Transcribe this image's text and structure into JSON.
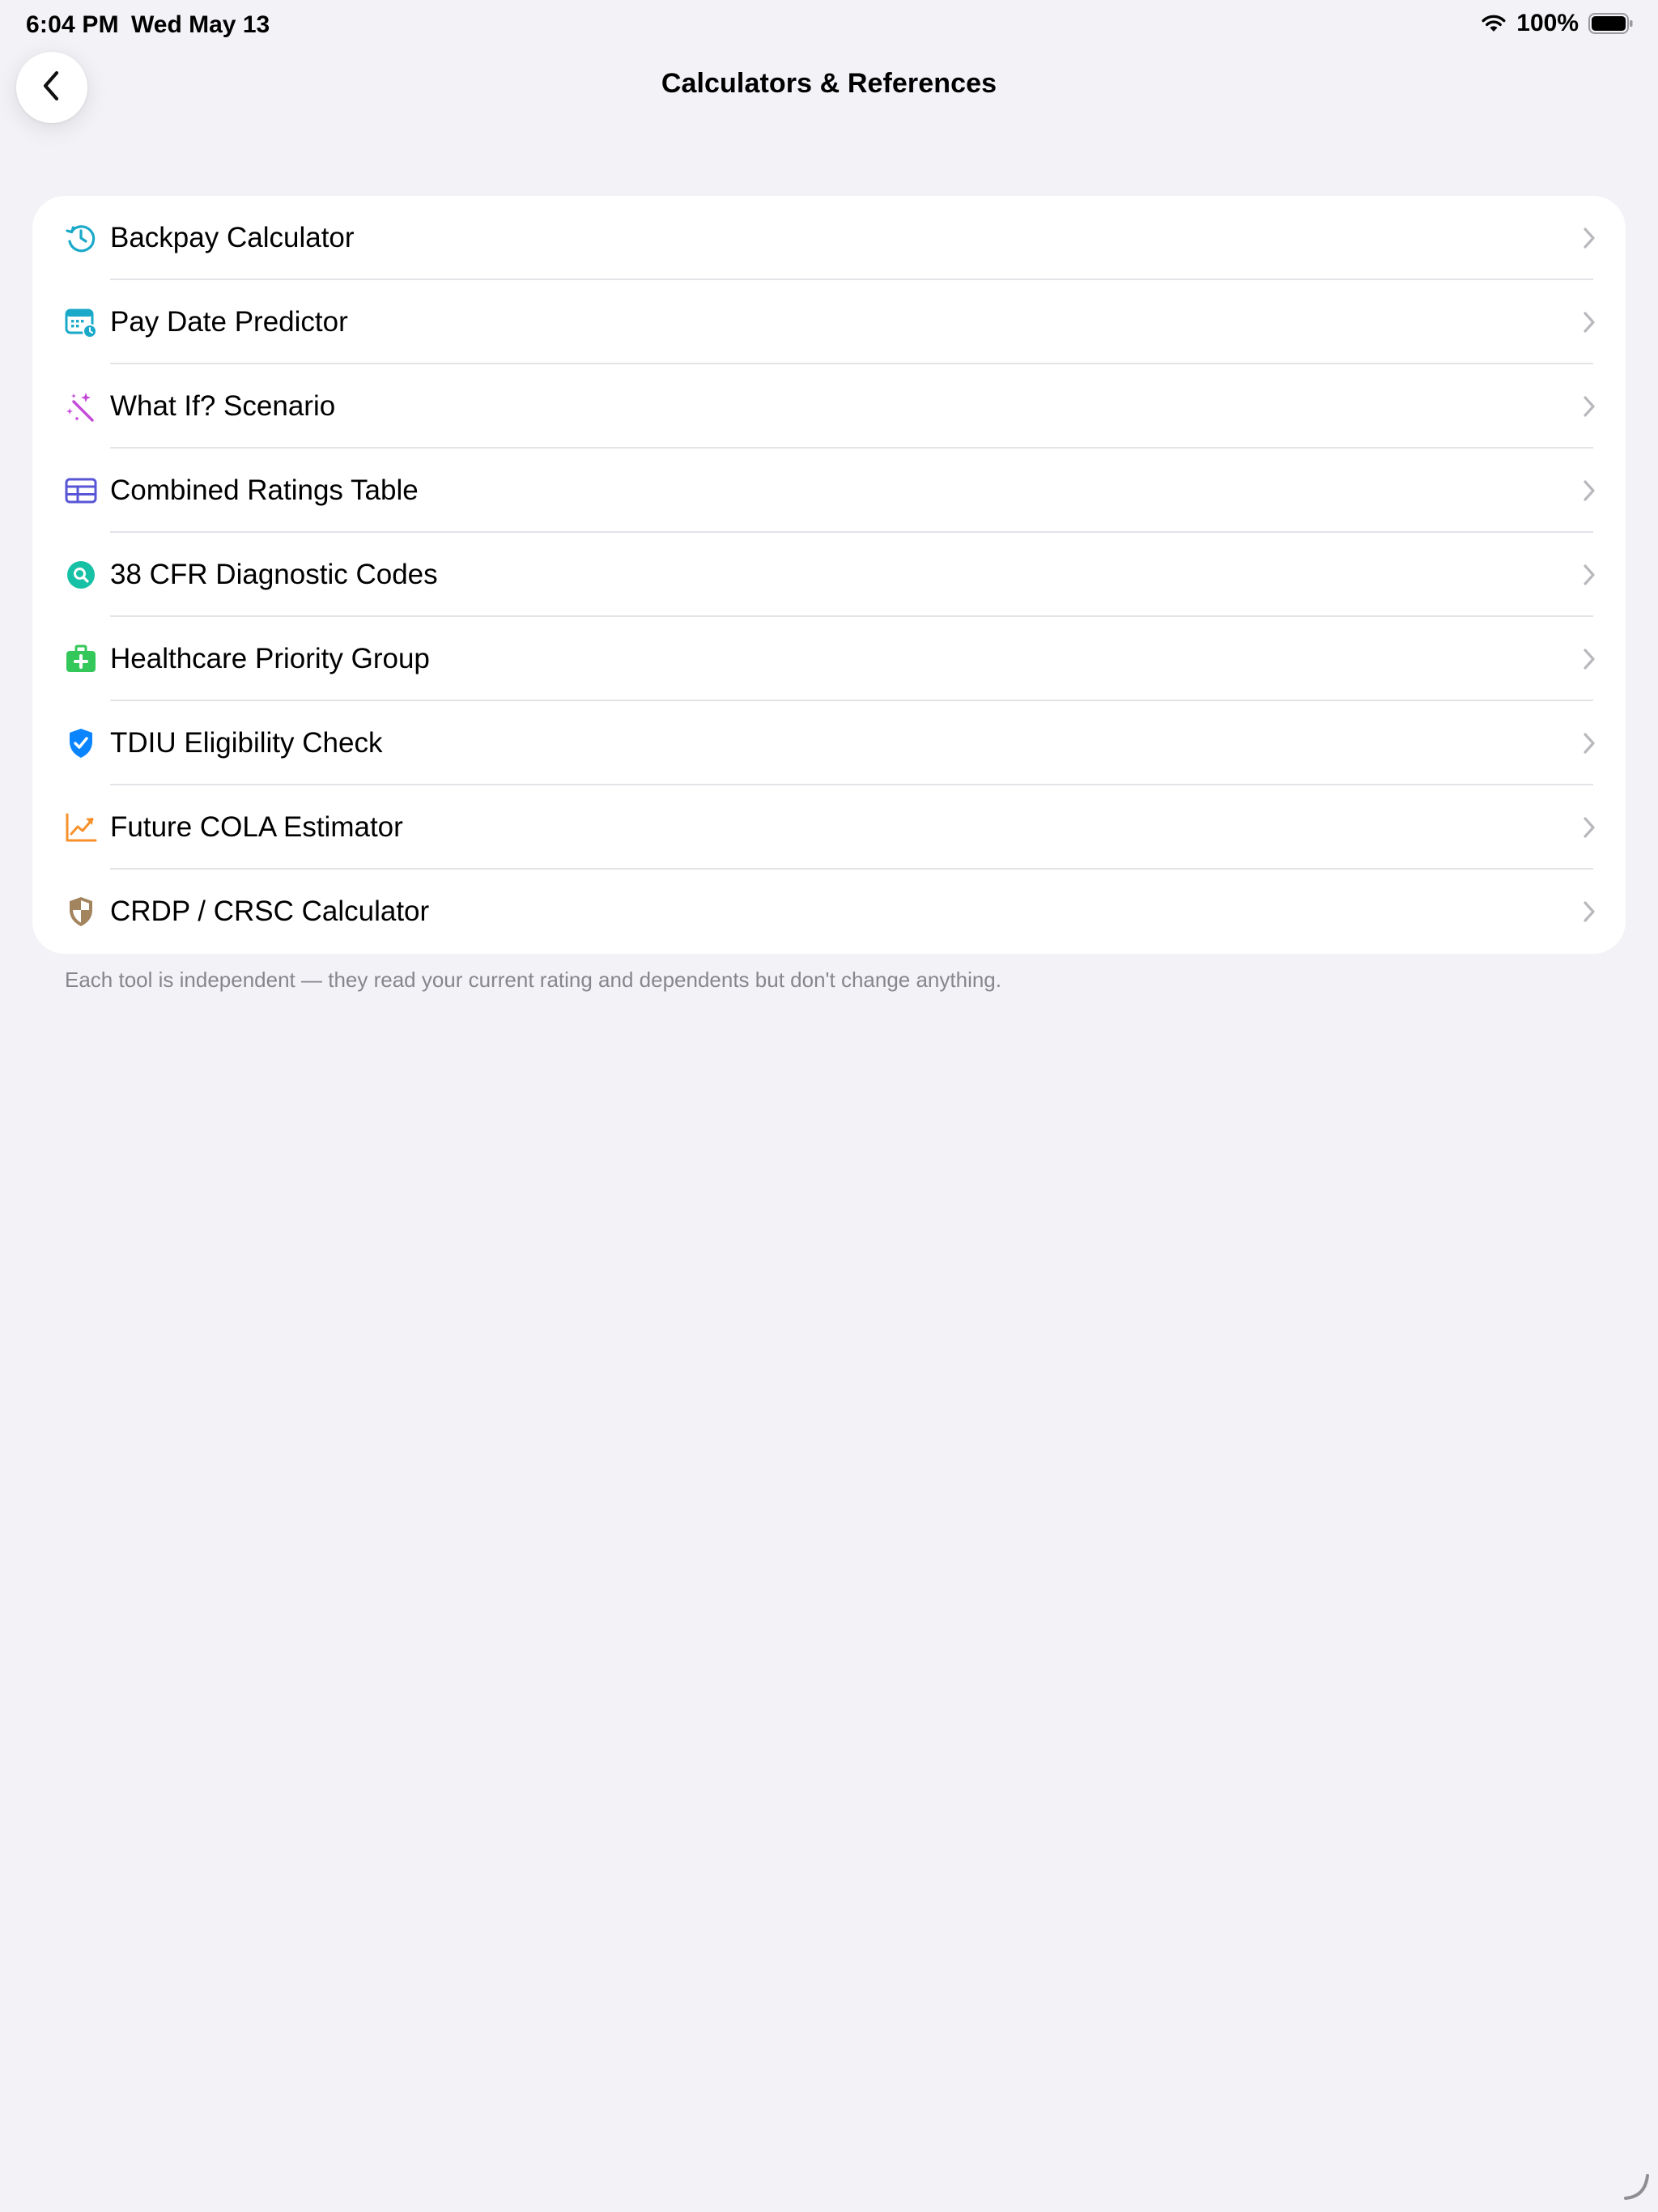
{
  "status_bar": {
    "time": "6:04 PM",
    "date": "Wed May 13",
    "battery": "100%"
  },
  "nav": {
    "title": "Calculators & References",
    "back_icon": "chevron-left-icon"
  },
  "rows": [
    {
      "label": "Backpay Calculator",
      "icon": "clock-history-icon",
      "color": "#1aa9c9"
    },
    {
      "label": "Pay Date Predictor",
      "icon": "calendar-badge-icon",
      "color": "#1aa9c9"
    },
    {
      "label": "What If? Scenario",
      "icon": "magic-wand-icon",
      "color": "#c44ad9"
    },
    {
      "label": "Combined Ratings Table",
      "icon": "table-icon",
      "color": "#5856d6"
    },
    {
      "label": "38 CFR Diagnostic Codes",
      "icon": "magnifier-circle-icon",
      "color": "#17c1a6"
    },
    {
      "label": "Healthcare Priority Group",
      "icon": "medical-bag-icon",
      "color": "#34c759"
    },
    {
      "label": "TDIU Eligibility Check",
      "icon": "checkmark-shield-icon",
      "color": "#0a84ff"
    },
    {
      "label": "Future COLA Estimator",
      "icon": "trend-up-icon",
      "color": "#f7902b"
    },
    {
      "label": "CRDP / CRSC Calculator",
      "icon": "split-shield-icon",
      "color": "#a2845e"
    }
  ],
  "footnote": "Each tool is independent — they read your current rating and dependents but don't change anything."
}
